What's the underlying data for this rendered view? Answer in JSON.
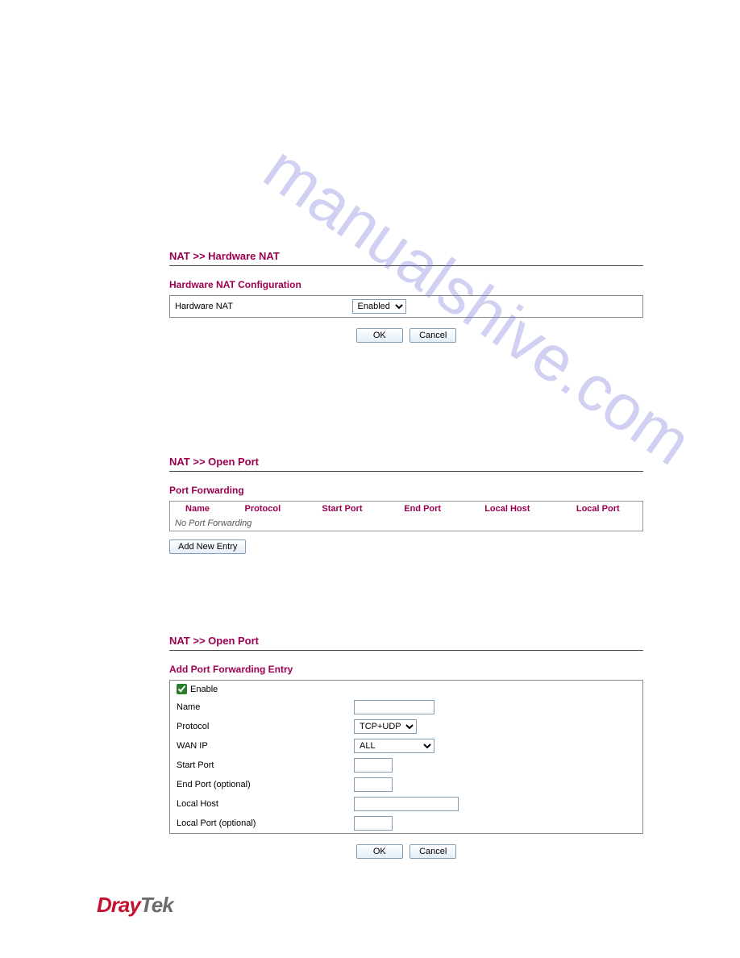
{
  "watermark": "manualshive.com",
  "hw_nat": {
    "title": "NAT >> Hardware NAT",
    "subtitle": "Hardware NAT Configuration",
    "label": "Hardware NAT",
    "select_value": "Enabled",
    "ok": "OK",
    "cancel": "Cancel"
  },
  "open_port": {
    "title": "NAT >> Open Port",
    "subtitle": "Port Forwarding",
    "headers": {
      "name": "Name",
      "protocol": "Protocol",
      "start_port": "Start Port",
      "end_port": "End Port",
      "local_host": "Local Host",
      "local_port": "Local Port"
    },
    "empty": "No Port Forwarding",
    "add_btn": "Add New Entry"
  },
  "open_port2": {
    "title": "NAT >> Open Port",
    "subtitle": "Add Port Forwarding Entry",
    "enable": "Enable",
    "name": "Name",
    "protocol": "Protocol",
    "protocol_value": "TCP+UDP",
    "wanip": "WAN IP",
    "wanip_value": "ALL",
    "start_port": "Start Port",
    "end_port": "End Port (optional)",
    "local_host": "Local Host",
    "local_port": "Local Port (optional)",
    "ok": "OK",
    "cancel": "Cancel"
  },
  "logo": {
    "dray": "Dray",
    "tek": "Tek"
  }
}
